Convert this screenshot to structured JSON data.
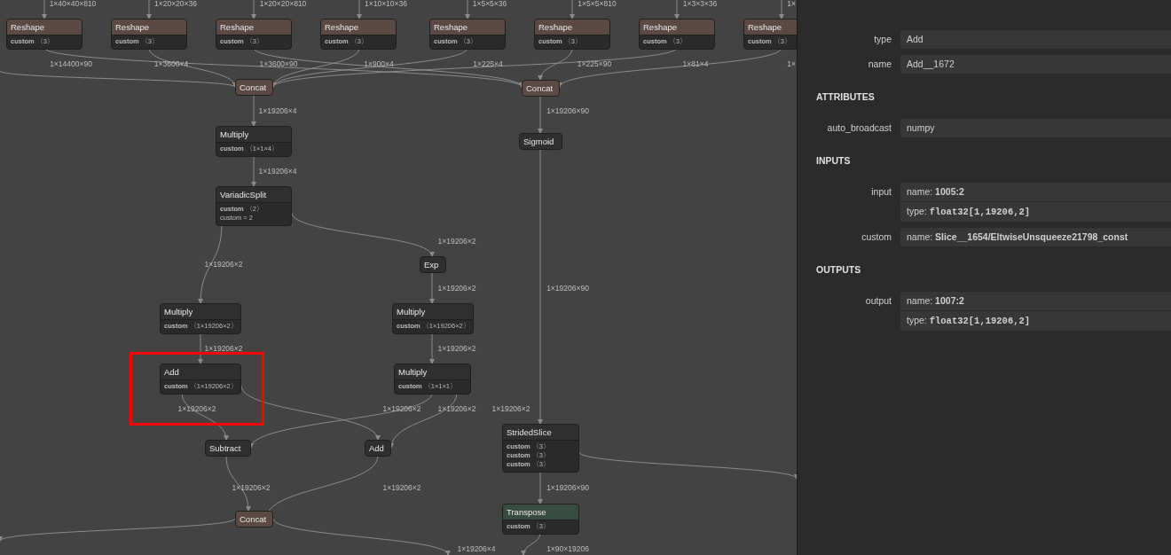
{
  "graph": {
    "nodes": [
      {
        "title": "Reshape",
        "color": "#5b4943",
        "selected": false,
        "attributes": [
          {
            "kind": "input",
            "name": "custom",
            "value": "〈3〉"
          }
        ]
      },
      {
        "title": "Reshape",
        "color": "#5b4943",
        "selected": false,
        "attributes": [
          {
            "kind": "input",
            "name": "custom",
            "value": "〈3〉"
          }
        ]
      },
      {
        "title": "Reshape",
        "color": "#5b4943",
        "selected": false,
        "attributes": [
          {
            "kind": "input",
            "name": "custom",
            "value": "〈3〉"
          }
        ]
      },
      {
        "title": "Reshape",
        "color": "#5b4943",
        "selected": false,
        "attributes": [
          {
            "kind": "input",
            "name": "custom",
            "value": "〈3〉"
          }
        ]
      },
      {
        "title": "Reshape",
        "color": "#5b4943",
        "selected": false,
        "attributes": [
          {
            "kind": "input",
            "name": "custom",
            "value": "〈3〉"
          }
        ]
      },
      {
        "title": "Reshape",
        "color": "#5b4943",
        "selected": false,
        "attributes": [
          {
            "kind": "input",
            "name": "custom",
            "value": "〈3〉"
          }
        ]
      },
      {
        "title": "Reshape",
        "color": "#5b4943",
        "selected": false,
        "attributes": [
          {
            "kind": "input",
            "name": "custom",
            "value": "〈3〉"
          }
        ]
      },
      {
        "title": "Reshape",
        "color": "#5b4943",
        "selected": false,
        "attributes": [
          {
            "kind": "input",
            "name": "custom",
            "value": "〈3〉"
          }
        ]
      },
      {
        "title": "Concat",
        "color": "#5b4943",
        "selected": false
      },
      {
        "title": "Concat",
        "color": "#5b4943",
        "selected": false
      },
      {
        "title": "Multiply",
        "color": "#2f2f2f",
        "selected": false,
        "attributes": [
          {
            "kind": "input",
            "name": "custom",
            "value": "〈1×1×4〉"
          }
        ]
      },
      {
        "title": "VariadicSplit",
        "color": "#2f2f2f",
        "selected": false,
        "attributes": [
          {
            "kind": "input",
            "name": "custom",
            "value": "〈2〉"
          },
          {
            "kind": "attribute",
            "name": "custom",
            "value": "= 2"
          }
        ]
      },
      {
        "title": "Sigmoid",
        "color": "#2f2f2f",
        "selected": false
      },
      {
        "title": "Exp",
        "color": "#2f2f2f",
        "selected": false
      },
      {
        "title": "Multiply",
        "color": "#2f2f2f",
        "selected": false,
        "attributes": [
          {
            "kind": "input",
            "name": "custom",
            "value": "〈1×19206×2〉"
          }
        ]
      },
      {
        "title": "Multiply",
        "color": "#2f2f2f",
        "selected": false,
        "attributes": [
          {
            "kind": "input",
            "name": "custom",
            "value": "〈1×19206×2〉"
          }
        ]
      },
      {
        "title": "Add",
        "color": "#2f2f2f",
        "selected": true,
        "attributes": [
          {
            "kind": "input",
            "name": "custom",
            "value": "〈1×19206×2〉"
          }
        ]
      },
      {
        "title": "Multiply",
        "color": "#2f2f2f",
        "selected": false,
        "attributes": [
          {
            "kind": "input",
            "name": "custom",
            "value": "〈1×1×1〉"
          }
        ]
      },
      {
        "title": "Subtract",
        "color": "#2f2f2f",
        "selected": false
      },
      {
        "title": "Add",
        "color": "#2f2f2f",
        "selected": false
      },
      {
        "title": "StridedSlice",
        "color": "#2f2f2f",
        "selected": false,
        "attributes": [
          {
            "kind": "input",
            "name": "custom",
            "value": "〈3〉"
          },
          {
            "kind": "input",
            "name": "custom",
            "value": "〈3〉"
          },
          {
            "kind": "input",
            "name": "custom",
            "value": "〈3〉"
          }
        ]
      },
      {
        "title": "Concat",
        "color": "#5b4943",
        "selected": false
      },
      {
        "title": "Transpose",
        "color": "#384b40",
        "selected": false,
        "attributes": [
          {
            "kind": "input",
            "name": "custom",
            "value": "〈3〉"
          }
        ]
      }
    ],
    "edge_labels": [
      "1×40×40×810",
      "1×20×20×36",
      "1×20×20×810",
      "1×10×10×36",
      "1×5×5×36",
      "1×5×5×810",
      "1×3×3×36",
      "1×",
      "1×14400×90",
      "1×3600×4",
      "1×3600×90",
      "1×900×4",
      "1×225×4",
      "1×225×90",
      "1×81×4",
      "1×",
      "1×19206×4",
      "1×19206×90",
      "1×19206×4",
      "1×19206×2",
      "1×19206×2",
      "1×19206×2",
      "1×19206×90",
      "1×19206×2",
      "1×19206×2",
      "1×19206×2",
      "1×19206×2",
      "1×19206×2",
      "1×19206×2",
      "1×19206×2",
      "1×19206×2",
      "1×19206×90",
      "1×19206×4",
      "1×90×19206"
    ]
  },
  "properties_panel": {
    "properties": [
      {
        "label": "type",
        "value": "Add"
      },
      {
        "label": "name",
        "value": "Add__1672"
      }
    ],
    "sections": [
      {
        "title": "ATTRIBUTES",
        "items": [
          {
            "label": "auto_broadcast",
            "lines": [
              {
                "kind": "plain",
                "value": "numpy"
              }
            ]
          }
        ]
      },
      {
        "title": "INPUTS",
        "items": [
          {
            "label": "input",
            "lines": [
              {
                "kind": "name",
                "prefix": "name:",
                "value": "1005:2"
              },
              {
                "kind": "type",
                "prefix": "type:",
                "value": "float32[1,19206,2]"
              }
            ]
          },
          {
            "label": "custom",
            "lines": [
              {
                "kind": "name",
                "prefix": "name:",
                "value": "Slice__1654/EltwiseUnsqueeze21798_const"
              }
            ]
          }
        ]
      },
      {
        "title": "OUTPUTS",
        "items": [
          {
            "label": "output",
            "lines": [
              {
                "kind": "name",
                "prefix": "name:",
                "value": "1007:2"
              },
              {
                "kind": "type",
                "prefix": "type:",
                "value": "float32[1,19206,2]"
              }
            ]
          }
        ]
      }
    ]
  }
}
